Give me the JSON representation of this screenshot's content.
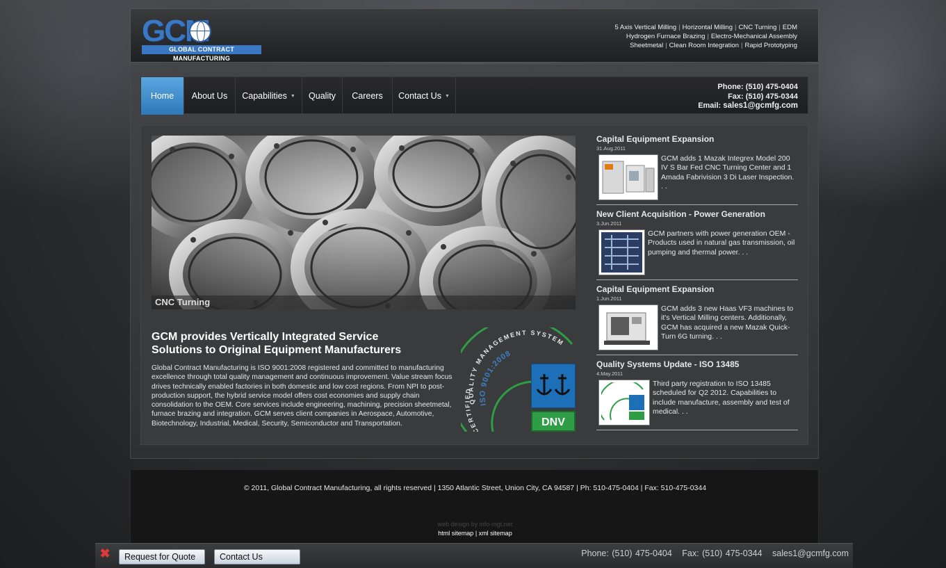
{
  "header": {
    "logo_letters": "GCM",
    "logo_subtitle": "GLOBAL CONTRACT MANUFACTURING",
    "services_lines": [
      [
        "5 Axis Vertical Milling",
        "Horizontal Milling",
        "CNC Turning",
        "EDM"
      ],
      [
        "Hydrogen Furnace Brazing",
        "Electro-Mechanical Assembly"
      ],
      [
        "Sheetmetal",
        "Clean Room Integration",
        "Rapid Prototyping"
      ]
    ]
  },
  "nav": {
    "items": [
      {
        "label": "Home",
        "active": true,
        "dropdown": false
      },
      {
        "label": "About Us",
        "active": false,
        "dropdown": false
      },
      {
        "label": "Capabilities",
        "active": false,
        "dropdown": true
      },
      {
        "label": "Quality",
        "active": false,
        "dropdown": false
      },
      {
        "label": "Careers",
        "active": false,
        "dropdown": false
      },
      {
        "label": "Contact Us",
        "active": false,
        "dropdown": true
      }
    ],
    "phone_label": "Phone:",
    "phone": "(510) 475-0404",
    "fax_label": "Fax:",
    "fax": "(510) 475-0344",
    "email_label": "Email:",
    "email": "sales1@gcmfg.com"
  },
  "hero": {
    "caption": "CNC Turning"
  },
  "intro": {
    "title_line1": "GCM provides Vertically Integrated Service",
    "title_line2": "Solutions to Original Equipment Manufacturers",
    "body": "Global Contract Manufacturing is ISO 9001:2008 registered and committed to manufacturing excellence through total quality management and continuous improvement. Value stream focus drives technically enabled factories in both domestic and low cost regions. From NPI to post-production support, the hybrid service model offers cost economies and supply chain consolidation to the OEM. Core services include engineering, machining, precision sheetmetal, furnace brazing and integration. GCM serves client companies in Aerospace, Automotive, Biotechnology, Industrial, Medical, Security, Semiconductor and Transportation."
  },
  "certification": {
    "arc_text_top": "QUALITY MANAGEMENT SYSTEM",
    "arc_text_iso": "ISO 9001:2008",
    "arc_text_side": "CERTIFIED",
    "badge": "DNV"
  },
  "news": [
    {
      "title": "Capital Equipment Expansion",
      "date": "31.Aug.2011",
      "text": "GCM adds 1 Mazak Integrex Model 200 IV S Bar Fed CNC Turning Center and 1 Amada Fabrivision 3 Di Laser Inspection. . ."
    },
    {
      "title": "New Client Acquisition - Power Generation",
      "date": "3.Jun.2011",
      "text": "GCM partners with  power generation OEM - Products used in natural gas transmission, oil pumping and thermal power. . ."
    },
    {
      "title": "Capital Equipment Expansion",
      "date": "1.Jun.2011",
      "text": "GCM adds 3 new Haas VF3 machines to it's Vertical Milling centers.  Additionally, GCM has acquired a new Mazak Quick-Turn 6G turning. . ."
    },
    {
      "title": "Quality Systems Update - ISO 13485",
      "date": "4.May.2011",
      "text": "Third party registration to ISO 13485 scheduled for Q2 2012. Capabilities to include manufacture, assembly and test of medical. . ."
    }
  ],
  "footer": {
    "copyright": "© 2011, Global Contract Manufacturing, all rights reserved  |  1350 Atlantic Street, Union City, CA 94587  |  Ph: 510-475-0404 |  Fax: 510-475-0344",
    "credit": "web design by info-mgt.net",
    "html_sitemap": "html sitemap",
    "xml_sitemap": "xml sitemap",
    "sitemap_sep": "|"
  },
  "bottombar": {
    "close": "✖",
    "quote_button": "Request for Quote",
    "contact_button": "Contact Us",
    "phone": "Phone: (510) 475-0404",
    "fax": "Fax: (510) 475-0344",
    "email": "sales1@gcmfg.com"
  },
  "colors": {
    "accent_blue": "#3a78c3",
    "nav_active": "#4a90cf",
    "dnv_green": "#2e9d45",
    "close_red": "#e03a3a"
  }
}
